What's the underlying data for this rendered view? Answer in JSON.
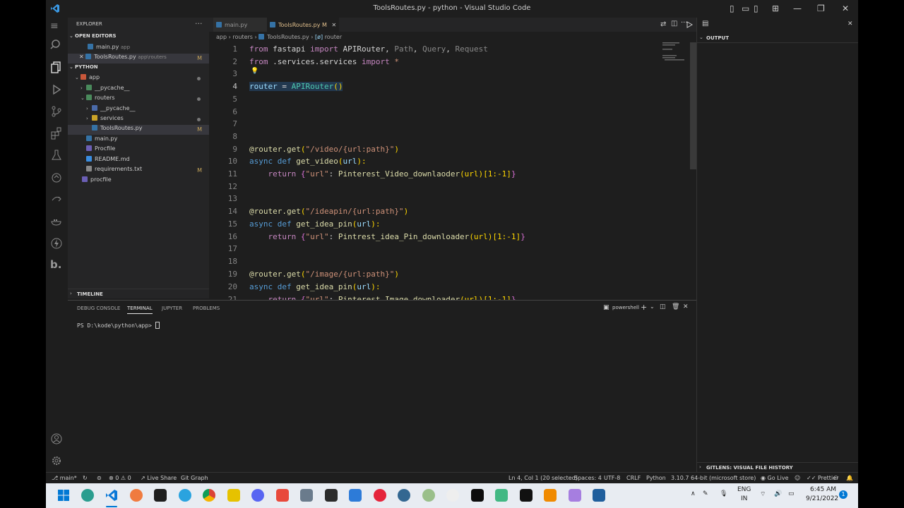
{
  "window": {
    "title": "ToolsRoutes.py - python - Visual Studio Code"
  },
  "sidebar": {
    "explorer_title": "EXPLORER",
    "open_editors_header": "OPEN EDITORS",
    "open_editors": [
      {
        "name": "main.py",
        "path": "app",
        "modified": ""
      },
      {
        "name": "ToolsRoutes.py",
        "path": "app\\routers",
        "modified": "M"
      }
    ],
    "workspace_header": "PYTHON",
    "tree": [
      {
        "name": "app",
        "type": "folder"
      },
      {
        "name": "__pycache__",
        "type": "folder"
      },
      {
        "name": "routers",
        "type": "folder"
      },
      {
        "name": "__pycache__",
        "type": "folder"
      },
      {
        "name": "services",
        "type": "folder"
      },
      {
        "name": "ToolsRoutes.py",
        "type": "file",
        "modified": "M"
      },
      {
        "name": "main.py",
        "type": "file"
      },
      {
        "name": "Procfile",
        "type": "file"
      },
      {
        "name": "README.md",
        "type": "file"
      },
      {
        "name": "requirements.txt",
        "type": "file",
        "modified": "M"
      },
      {
        "name": "procfile",
        "type": "file"
      }
    ],
    "timeline_header": "TIMELINE"
  },
  "tabs": [
    {
      "label": "main.py"
    },
    {
      "label": "ToolsRoutes.py",
      "badge": "M"
    }
  ],
  "breadcrumb": [
    "app",
    "routers",
    "ToolsRoutes.py",
    "router"
  ],
  "editor": {
    "line_numbers": [
      "1",
      "2",
      "3",
      "4",
      "5",
      "6",
      "7",
      "8",
      "9",
      "10",
      "11",
      "12",
      "13",
      "14",
      "15",
      "16",
      "17",
      "18",
      "19",
      "20",
      "21"
    ],
    "current_line": "4"
  },
  "output_panel": {
    "title": "OUTPUT",
    "gitlens": "GITLENS: VISUAL FILE HISTORY"
  },
  "terminal": {
    "tabs": [
      "DEBUG CONSOLE",
      "TERMINAL",
      "JUPYTER",
      "PROBLEMS"
    ],
    "active_tab": "TERMINAL",
    "shell": "powershell",
    "prompt": "PS D:\\kode\\python\\app>"
  },
  "statusbar": {
    "branch": "main*",
    "problems": "⊗ 0 ⚠ 0",
    "liveshare": "Live Share",
    "gitgraph": "Git Graph",
    "cursor": "Ln 4, Col 1 (20 selected)",
    "spaces": "Spaces: 4",
    "encoding": "UTF-8",
    "eol": "CRLF",
    "language": "Python",
    "interpreter": "3.10.7 64-bit (microsoft store)",
    "golive": "Go Live",
    "prettier": "Prettier"
  },
  "taskbar": {
    "lang": "ENG",
    "region": "IN",
    "time": "6:45 AM",
    "date": "9/21/2022",
    "notifications": "1"
  },
  "colors": {
    "accent": "#0078d4",
    "keyword": "#c586c0",
    "string": "#ce9178",
    "function": "#dcdcaa"
  }
}
